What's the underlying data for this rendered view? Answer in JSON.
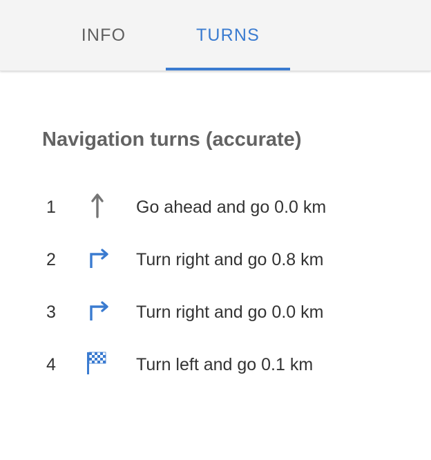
{
  "tabs": [
    {
      "label": "INFO",
      "active": false
    },
    {
      "label": "TURNS",
      "active": true
    }
  ],
  "section_title": "Navigation turns (accurate)",
  "colors": {
    "accent": "#3a7bd0",
    "text": "#333333",
    "muted": "#636363",
    "arrow_gray": "#757575"
  },
  "turns": [
    {
      "number": "1",
      "icon": "straight-arrow-icon",
      "text": "Go ahead and go 0.0 km"
    },
    {
      "number": "2",
      "icon": "turn-right-arrow-icon",
      "text": "Turn right and go 0.8 km"
    },
    {
      "number": "3",
      "icon": "turn-right-arrow-icon",
      "text": "Turn right and go 0.0 km"
    },
    {
      "number": "4",
      "icon": "checkered-flag-icon",
      "text": "Turn left and go 0.1 km"
    }
  ]
}
